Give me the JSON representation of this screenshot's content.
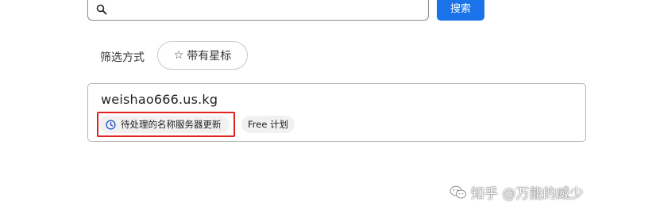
{
  "search": {
    "value": "",
    "button_label": "搜索"
  },
  "filter": {
    "label": "筛选方式",
    "starred_chip_label": "带有星标"
  },
  "domain_card": {
    "domain": "weishao666.us.kg",
    "status": "待处理的名称服务器更新",
    "plan": "Free 计划"
  },
  "watermark": {
    "text": "知乎 @万能的威少"
  },
  "colors": {
    "accent": "#1a73e8",
    "highlight": "#e0231d",
    "chip_bg": "#f1f1f1"
  },
  "icons": {
    "search": "search-icon",
    "star": "star-outline-icon",
    "status": "clock-icon",
    "watermark": "wechat-icon"
  }
}
